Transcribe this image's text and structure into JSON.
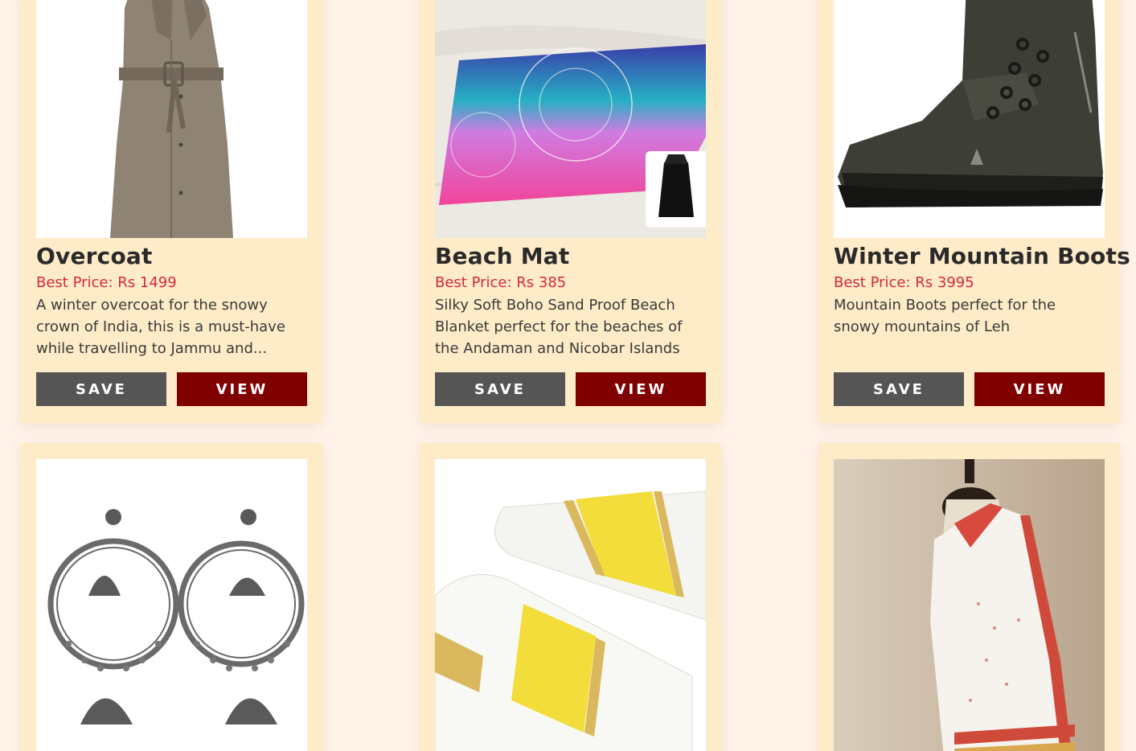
{
  "products": [
    {
      "title": "Overcoat",
      "price": "Best Price: Rs 1499",
      "description": "A winter overcoat for the snowy crown of India, this is a must-have while travelling to Jammu and...",
      "save_label": "SAVE",
      "view_label": "VIEW",
      "image": "overcoat"
    },
    {
      "title": "Beach Mat",
      "price": "Best Price: Rs 385",
      "description": "Silky Soft Boho Sand Proof Beach Blanket perfect for the beaches of the Andaman and Nicobar Islands",
      "save_label": "SAVE",
      "view_label": "VIEW",
      "image": "beach-mat"
    },
    {
      "title": "Winter Mountain Boots",
      "price": "Best Price: Rs 3995",
      "description": "Mountain Boots perfect for the snowy mountains of Leh",
      "save_label": "SAVE",
      "view_label": "VIEW",
      "image": "boots"
    },
    {
      "image": "jhumka-earrings"
    },
    {
      "image": "kerala-mundu"
    },
    {
      "image": "saree"
    }
  ],
  "colors": {
    "page_background": "#fff3ea",
    "card_background": "#feebc8",
    "price": "#d42a3a",
    "save_button": "#555555",
    "view_button": "#800000"
  }
}
